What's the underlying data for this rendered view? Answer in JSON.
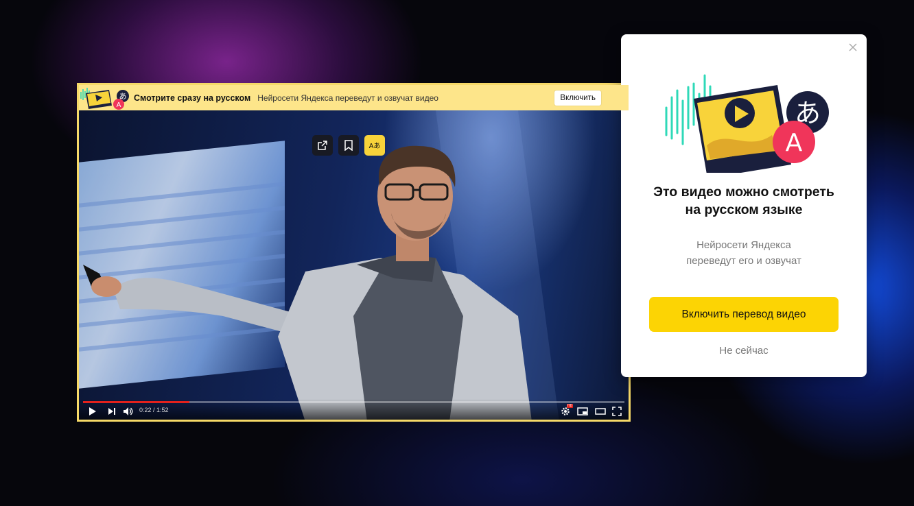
{
  "banner": {
    "title": "Смотрите сразу на русском",
    "subtitle": "Нейросети Яндекса переведут и озвучат видео",
    "enable_label": "Включить",
    "logo_glyphs": {
      "letter": "A",
      "kana": "あ"
    }
  },
  "video_overlay": {
    "buttons": [
      {
        "icon": "share-icon"
      },
      {
        "icon": "bookmark-icon"
      },
      {
        "icon": "translate-icon",
        "label": "Aあ"
      }
    ]
  },
  "player": {
    "time": "0:22 / 1:52",
    "progress_fraction": 0.196,
    "hd_badge": "HD",
    "controls": [
      "play-icon",
      "next-icon",
      "volume-icon",
      "settings-icon",
      "miniplayer-icon",
      "theater-icon",
      "fullscreen-icon"
    ]
  },
  "popup": {
    "title_line1": "Это видео можно смотреть",
    "title_line2": "на русском языке",
    "desc_line1": "Нейросети Яндекса",
    "desc_line2": "переведут его и озвучат",
    "cta_label": "Включить перевод видео",
    "later_label": "Не сейчас",
    "illustration_glyphs": {
      "letter": "A",
      "kana": "あ"
    }
  },
  "colors": {
    "accent_yellow": "#fcd404",
    "banner_yellow": "#fde58a",
    "progress_red": "#e3211c",
    "teal": "#2fd9b8",
    "pink": "#f0355a",
    "navy": "#1a1f3d"
  }
}
